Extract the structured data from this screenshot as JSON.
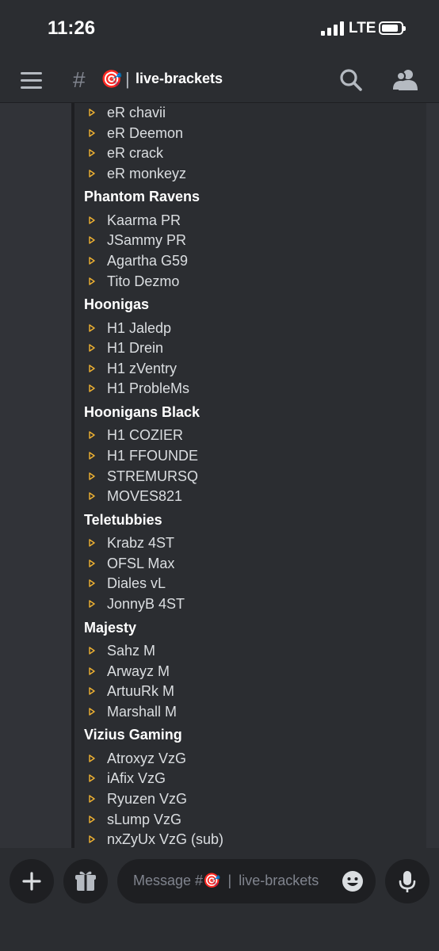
{
  "status_bar": {
    "time": "11:26",
    "network": "LTE"
  },
  "header": {
    "hash": "#",
    "channel_emoji": "🎯",
    "separator": "|",
    "channel_name": "live-brackets",
    "icons": [
      "hamburger-menu-icon",
      "search-icon",
      "members-icon"
    ]
  },
  "roster": {
    "bullet_icon": "triangle-right-icon",
    "bullet_color": "#f0b232",
    "lines": [
      {
        "type": "player",
        "text": "eR chavii"
      },
      {
        "type": "player",
        "text": "eR Deemon"
      },
      {
        "type": "player",
        "text": "eR crack"
      },
      {
        "type": "player",
        "text": "eR monkeyz"
      },
      {
        "type": "team",
        "text": "Phantom Ravens"
      },
      {
        "type": "player",
        "text": "Kaarma PR"
      },
      {
        "type": "player",
        "text": "JSammy PR"
      },
      {
        "type": "player",
        "text": "Agartha G59"
      },
      {
        "type": "player",
        "text": "Tito Dezmo"
      },
      {
        "type": "team",
        "text": "Hoonigas"
      },
      {
        "type": "player",
        "text": "H1 Jaledp"
      },
      {
        "type": "player",
        "text": "H1 Drein"
      },
      {
        "type": "player",
        "text": "H1 zVentry"
      },
      {
        "type": "player",
        "text": "H1 ProbleMs"
      },
      {
        "type": "team",
        "text": "Hoonigans Black"
      },
      {
        "type": "player",
        "text": "H1 COZIER"
      },
      {
        "type": "player",
        "text": "H1 FFOUNDE"
      },
      {
        "type": "player",
        "text": "STREMURSQ"
      },
      {
        "type": "player",
        "text": "MOVES821"
      },
      {
        "type": "team",
        "text": "Teletubbies"
      },
      {
        "type": "player",
        "text": "Krabz 4ST"
      },
      {
        "type": "player",
        "text": "OFSL Max"
      },
      {
        "type": "player",
        "text": "Diales vL"
      },
      {
        "type": "player",
        "text": "JonnyB 4ST"
      },
      {
        "type": "team",
        "text": "Majesty"
      },
      {
        "type": "player",
        "text": "Sahz M"
      },
      {
        "type": "player",
        "text": "Arwayz M"
      },
      {
        "type": "player",
        "text": "ArtuuRk M"
      },
      {
        "type": "player",
        "text": "Marshall M"
      },
      {
        "type": "team",
        "text": "Vizius Gaming"
      },
      {
        "type": "player",
        "text": "Atroxyz VzG"
      },
      {
        "type": "player",
        "text": "iAfix VzG"
      },
      {
        "type": "player",
        "text": "Ryuzen VzG"
      },
      {
        "type": "player",
        "text": "sLump VzG"
      },
      {
        "type": "player",
        "text": "nxZyUx VzG (sub)"
      }
    ]
  },
  "composer": {
    "placeholder_prefix": "Message #",
    "placeholder_emoji": "🎯",
    "placeholder_separator": "|",
    "placeholder_channel": "live-brackets",
    "icons": [
      "plus-icon",
      "gift-icon",
      "emoji-icon",
      "microphone-icon"
    ]
  }
}
